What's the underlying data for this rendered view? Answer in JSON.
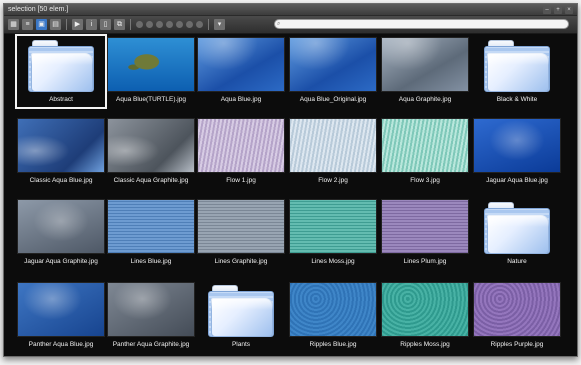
{
  "window": {
    "title": "selection [50 elem.]",
    "titlebar_buttons": [
      "minimize-icon",
      "zoom-icon",
      "close-icon"
    ]
  },
  "toolbar": {
    "tools": [
      "grid-view-icon",
      "list-view-icon",
      "preview-view-icon",
      "thumbnails-icon",
      "slideshow-icon",
      "info-icon",
      "page-icon",
      "copy-icon"
    ],
    "label_colors": [
      "#6c6c6c",
      "#6c6c6c",
      "#6c6c6c",
      "#6c6c6c",
      "#6c6c6c",
      "#6c6c6c",
      "#6c6c6c"
    ],
    "search": {
      "value": "",
      "placeholder": ""
    }
  },
  "items": [
    {
      "label": "Abstract",
      "kind": "folder",
      "selected": true
    },
    {
      "label": "Aqua Blue(TURTLE).jpg",
      "kind": "image",
      "thumb": "turtle"
    },
    {
      "label": "Aqua Blue.jpg",
      "kind": "image",
      "thumb": "aqua-blue"
    },
    {
      "label": "Aqua Blue_Original.jpg",
      "kind": "image",
      "thumb": "aqua-blue"
    },
    {
      "label": "Aqua Graphite.jpg",
      "kind": "image",
      "thumb": "aqua-graphite"
    },
    {
      "label": "Black & White",
      "kind": "folder"
    },
    {
      "label": "Classic Aqua Blue.jpg",
      "kind": "image",
      "thumb": "classic-blue"
    },
    {
      "label": "Classic Aqua Graphite.jpg",
      "kind": "image",
      "thumb": "classic-graphite"
    },
    {
      "label": "Flow 1.jpg",
      "kind": "image",
      "thumb": "flow1"
    },
    {
      "label": "Flow 2.jpg",
      "kind": "image",
      "thumb": "flow2"
    },
    {
      "label": "Flow 3.jpg",
      "kind": "image",
      "thumb": "flow3"
    },
    {
      "label": "Jaguar Aqua Blue.jpg",
      "kind": "image",
      "thumb": "jaguar-blue"
    },
    {
      "label": "Jaguar Aqua Graphite.jpg",
      "kind": "image",
      "thumb": "jaguar-graphite"
    },
    {
      "label": "Lines Blue.jpg",
      "kind": "image",
      "thumb": "lines-blue"
    },
    {
      "label": "Lines Graphite.jpg",
      "kind": "image",
      "thumb": "lines-graphite"
    },
    {
      "label": "Lines Moss.jpg",
      "kind": "image",
      "thumb": "lines-moss"
    },
    {
      "label": "Lines Plum.jpg",
      "kind": "image",
      "thumb": "lines-plum"
    },
    {
      "label": "Nature",
      "kind": "folder"
    },
    {
      "label": "Panther Aqua Blue.jpg",
      "kind": "image",
      "thumb": "panther-blue"
    },
    {
      "label": "Panther Aqua Graphite.jpg",
      "kind": "image",
      "thumb": "panther-graphite"
    },
    {
      "label": "Plants",
      "kind": "folder"
    },
    {
      "label": "Ripples Blue.jpg",
      "kind": "image",
      "thumb": "ripples-blue"
    },
    {
      "label": "Ripples Moss.jpg",
      "kind": "image",
      "thumb": "ripples-moss"
    },
    {
      "label": "Ripples Purple.jpg",
      "kind": "image",
      "thumb": "ripples-purple"
    }
  ]
}
